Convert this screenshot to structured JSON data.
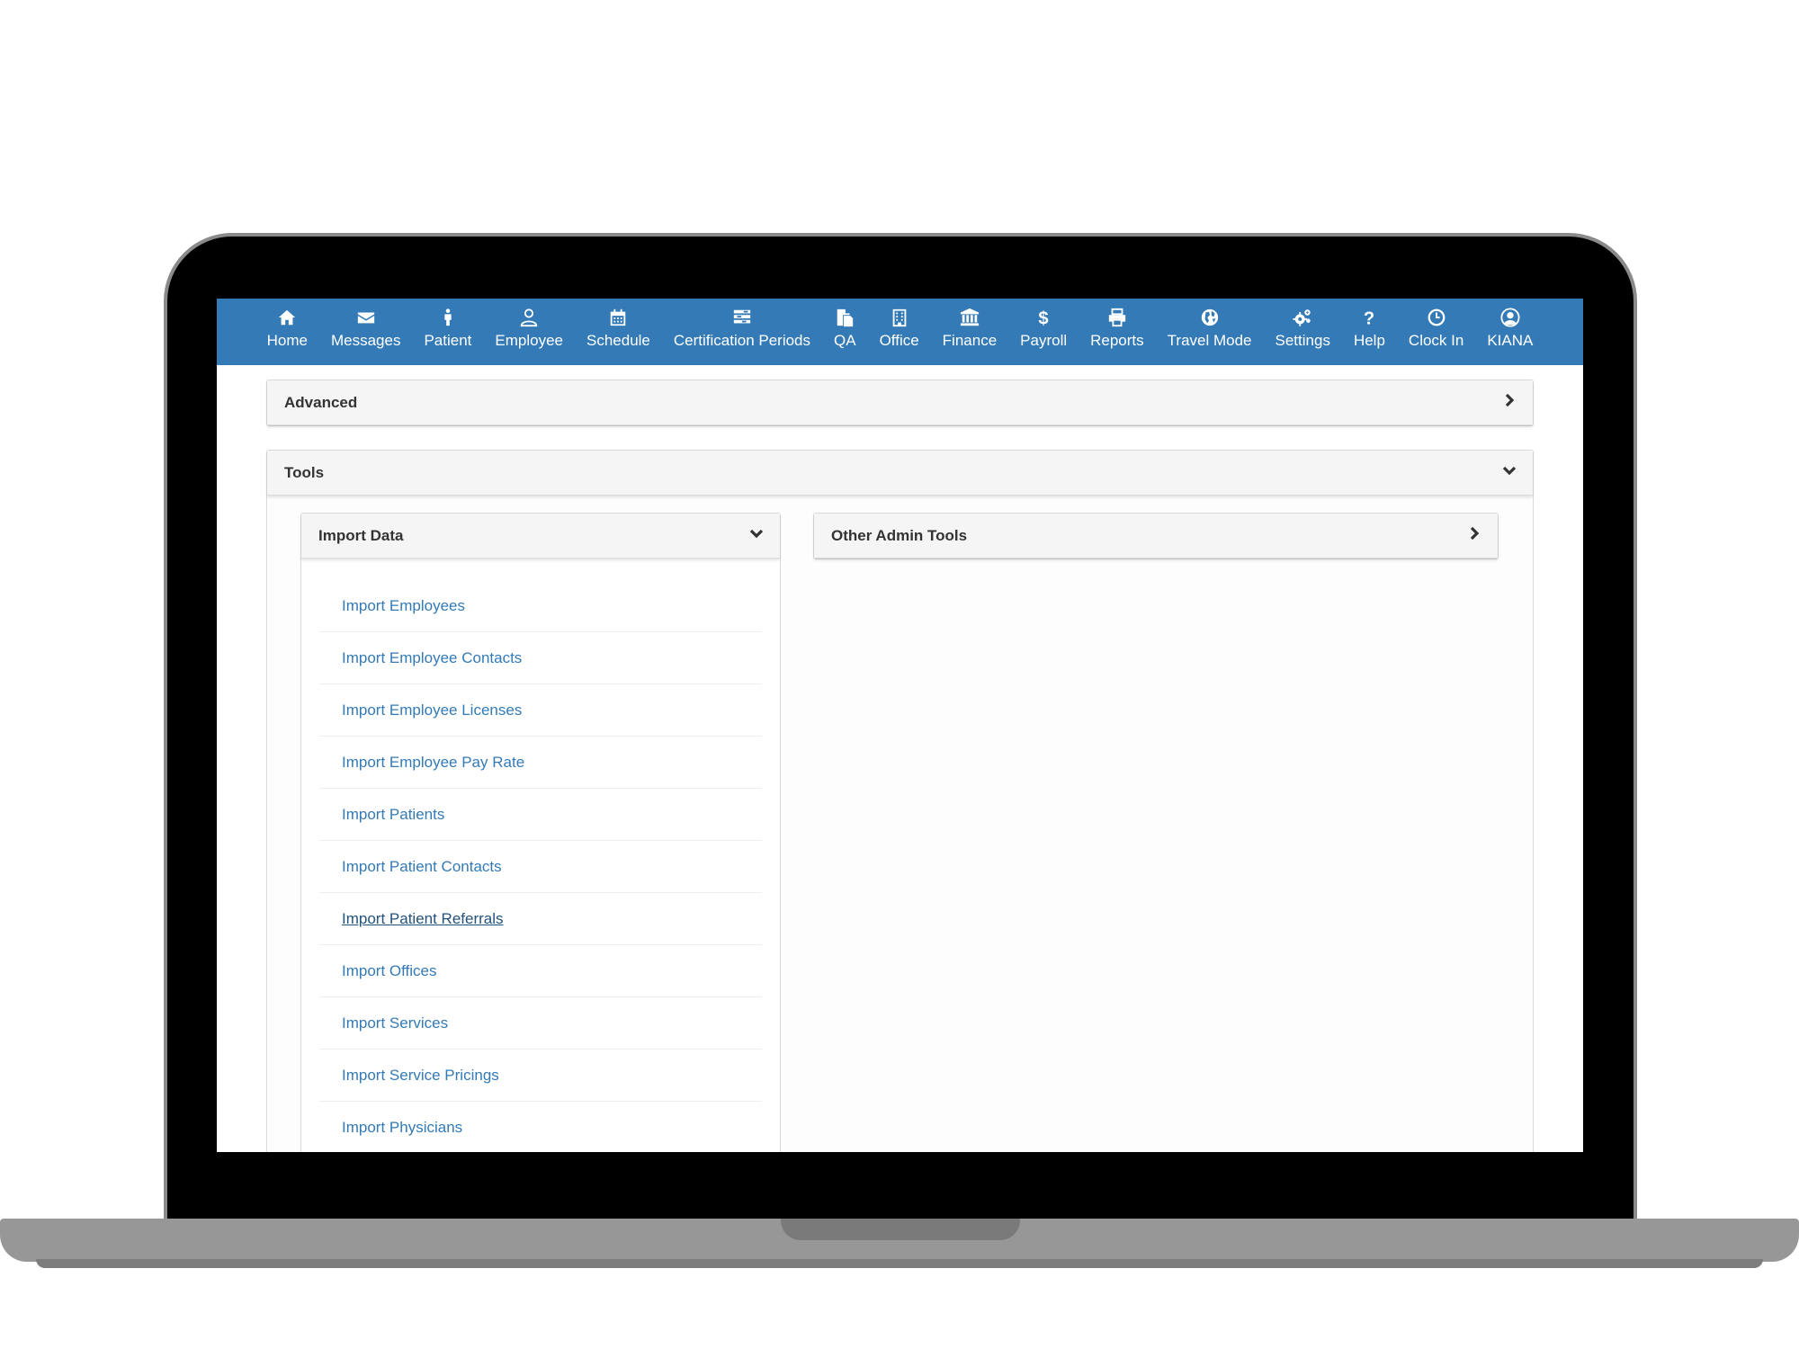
{
  "nav": {
    "items": [
      {
        "label": "Home",
        "icon": "home-icon"
      },
      {
        "label": "Messages",
        "icon": "envelope-icon"
      },
      {
        "label": "Patient",
        "icon": "person-icon"
      },
      {
        "label": "Employee",
        "icon": "user-outline-icon"
      },
      {
        "label": "Schedule",
        "icon": "calendar-icon"
      },
      {
        "label": "Certification Periods",
        "icon": "tasks-icon"
      },
      {
        "label": "QA",
        "icon": "documents-icon"
      },
      {
        "label": "Office",
        "icon": "building-icon"
      },
      {
        "label": "Finance",
        "icon": "bank-icon"
      },
      {
        "label": "Payroll",
        "icon": "dollar-icon"
      },
      {
        "label": "Reports",
        "icon": "printer-icon"
      },
      {
        "label": "Travel Mode",
        "icon": "globe-icon"
      },
      {
        "label": "Settings",
        "icon": "gears-icon"
      },
      {
        "label": "Help",
        "icon": "question-icon"
      },
      {
        "label": "Clock In",
        "icon": "clock-icon"
      },
      {
        "label": "KIANA",
        "icon": "user-circle-icon"
      }
    ],
    "background": "#337ab7"
  },
  "panels": {
    "advanced": {
      "title": "Advanced",
      "chevron": "right"
    },
    "tools": {
      "title": "Tools",
      "chevron": "down"
    },
    "import_data": {
      "title": "Import Data",
      "chevron": "down",
      "links": [
        "Import Employees",
        "Import Employee Contacts",
        "Import Employee Licenses",
        "Import Employee Pay Rate",
        "Import Patients",
        "Import Patient Contacts",
        "Import Patient Referrals",
        "Import Offices",
        "Import Services",
        "Import Service Pricings",
        "Import Physicians"
      ],
      "hovered_link": "Import Patient Referrals"
    },
    "other_admin_tools": {
      "title": "Other Admin Tools",
      "chevron": "right"
    }
  },
  "colors": {
    "link": "#337ab7",
    "link_hover": "#23527c"
  }
}
